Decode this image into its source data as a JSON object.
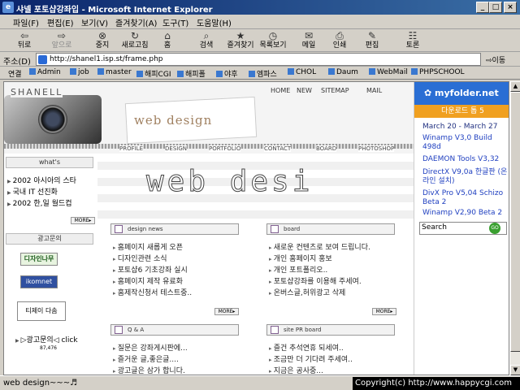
{
  "window": {
    "title": "샤넬 포토샵강좌입 - Microsoft Internet Explorer",
    "icon": "ie-icon",
    "controls": [
      "_",
      "□",
      "×"
    ]
  },
  "menu": [
    "파일(F)",
    "편집(E)",
    "보기(V)",
    "즐겨찾기(A)",
    "도구(T)",
    "도움말(H)"
  ],
  "toolbar": [
    {
      "label": "뒤로",
      "icon": "back-arrow-icon",
      "glyph": "⇦"
    },
    {
      "label": "앞으로",
      "icon": "forward-arrow-icon",
      "glyph": "⇨",
      "disabled": true
    },
    {
      "label": "중지",
      "icon": "stop-icon",
      "glyph": "⊗"
    },
    {
      "label": "새로고침",
      "icon": "refresh-icon",
      "glyph": "↻"
    },
    {
      "label": "홈",
      "icon": "home-icon",
      "glyph": "⌂"
    },
    {
      "label": "검색",
      "icon": "search-icon",
      "glyph": "⌕"
    },
    {
      "label": "즐겨찾기",
      "icon": "favorites-icon",
      "glyph": "★"
    },
    {
      "label": "목록보기",
      "icon": "history-icon",
      "glyph": "◷"
    },
    {
      "label": "메일",
      "icon": "mail-icon",
      "glyph": "✉"
    },
    {
      "label": "인쇄",
      "icon": "print-icon",
      "glyph": "⎙"
    },
    {
      "label": "편집",
      "icon": "edit-icon",
      "glyph": "✎"
    },
    {
      "label": "토론",
      "icon": "discuss-icon",
      "glyph": "☷"
    }
  ],
  "address": {
    "label": "주소(D)",
    "url": "http://shanel1.isp.st/frame.php",
    "go": "이동"
  },
  "links": {
    "label": "연결",
    "items": [
      "Admin",
      "job",
      "master",
      "해피CGI",
      "해피폴",
      "야후",
      "엠파스",
      "CHOL",
      "Daum",
      "WebMail",
      "PHPSCHOOL"
    ]
  },
  "page": {
    "logo": "SHANELL",
    "topnav": [
      "HOME",
      "NEW",
      "SITEMAP",
      "MAIL"
    ],
    "header_title": "web design",
    "subnav": [
      "PROFILE",
      "DESIGN",
      "PORTFOLIO",
      "CONTACT",
      "BOARD",
      "PHOTOSHOP"
    ],
    "hero_text": "web desi",
    "whats": {
      "title": "what's",
      "items": [
        "2002 아시아의 스타",
        "국내 IT 선진화",
        "2002 한,일 월드컵"
      ],
      "more": "MORE▸"
    },
    "ads": {
      "title": "광고문의",
      "items": [
        "디자인나무",
        "ikomnet",
        "티제이 다솜"
      ],
      "footer": "▷광고문의◁ click",
      "count": "87,476"
    },
    "design_news": {
      "title": "design news",
      "items": [
        "홈페이지 새롭게 오픈",
        "디자인관련 소식",
        "포토샵6 기초강좌 실시",
        "홈페이지 제작 유료화",
        "홈제작신청서 테스트중.."
      ],
      "more": "MORE▸"
    },
    "board": {
      "title": "board",
      "items": [
        "새로운 컨텐츠로 보여 드립니다.",
        "개인 홈페이지 홍보",
        "개인 포트폴리오..",
        "포토샵강좌를 이용해 주세여.",
        "온버스글,허위광고 삭제"
      ],
      "more": "MORE▸"
    },
    "qna": {
      "title": "Q & A",
      "items": [
        "질문은 강좌게시판에...",
        "즐거운 글,좋은글....",
        "광고글은 삼가 합니다."
      ]
    },
    "pr": {
      "title": "site PR board",
      "items": [
        "즐건 추석연휴 되세여..",
        "조금만 더 기다려 주세여..",
        "지금은 공사중..."
      ]
    }
  },
  "myfolder": {
    "title": "myfolder.net",
    "subtitle": "다운로드 톱 5",
    "date": "March 20 - March 27",
    "items": [
      "Winamp V3,0 Build 498d",
      "DAEMON Tools V3,32",
      "DirectX V9,0a 한글판 (온라인 설치)",
      "DivX Pro V5,04 Schizo Beta 2",
      "Winamp V2,90 Beta 2"
    ],
    "search_placeholder": "Search",
    "go": "GO"
  },
  "status": {
    "text": "web design~~~♬",
    "copyright": "Copyright(c) http://www.happycgi.com"
  }
}
